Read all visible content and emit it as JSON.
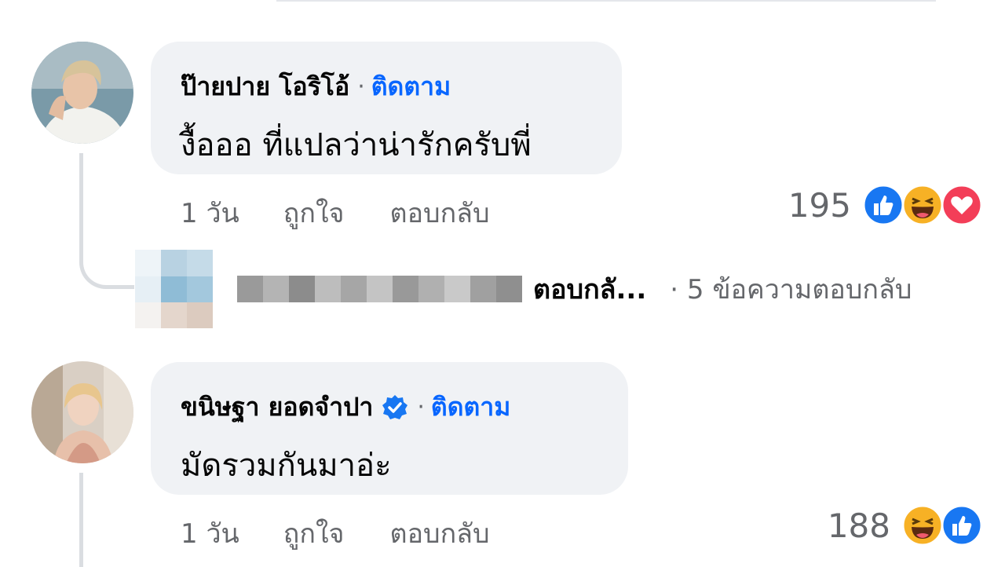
{
  "comments": [
    {
      "author": "ป๊ายปาย โอริโอ้",
      "separator": "·",
      "follow_label": "ติดตาม",
      "text": "งื้อออ ที่แปลว่าน่ารักครับพี่",
      "time": "1 วัน",
      "like_label": "ถูกใจ",
      "reply_label": "ตอบกลับ",
      "reaction_count": "195",
      "reactions": [
        "like-icon",
        "haha-icon",
        "love-icon"
      ],
      "verified": false,
      "reply_preview": {
        "snippet": "ตอบกลั...",
        "count_text": "· 5 ข้อความตอบกลับ"
      }
    },
    {
      "author": "ขนิษฐา ยอดจำปา",
      "separator": "·",
      "follow_label": "ติดตาม",
      "text": "มัดรวมกันมาอ่ะ",
      "time": "1 วัน",
      "like_label": "ถูกใจ",
      "reply_label": "ตอบกลับ",
      "reaction_count": "188",
      "reactions": [
        "haha-icon",
        "like-icon"
      ],
      "verified": true
    }
  ],
  "colors": {
    "link_blue": "#0866ff",
    "bubble_bg": "#f0f2f5",
    "secondary_text": "#65676b",
    "thread_line": "#dadde1",
    "verified_blue": "#1877f2"
  }
}
